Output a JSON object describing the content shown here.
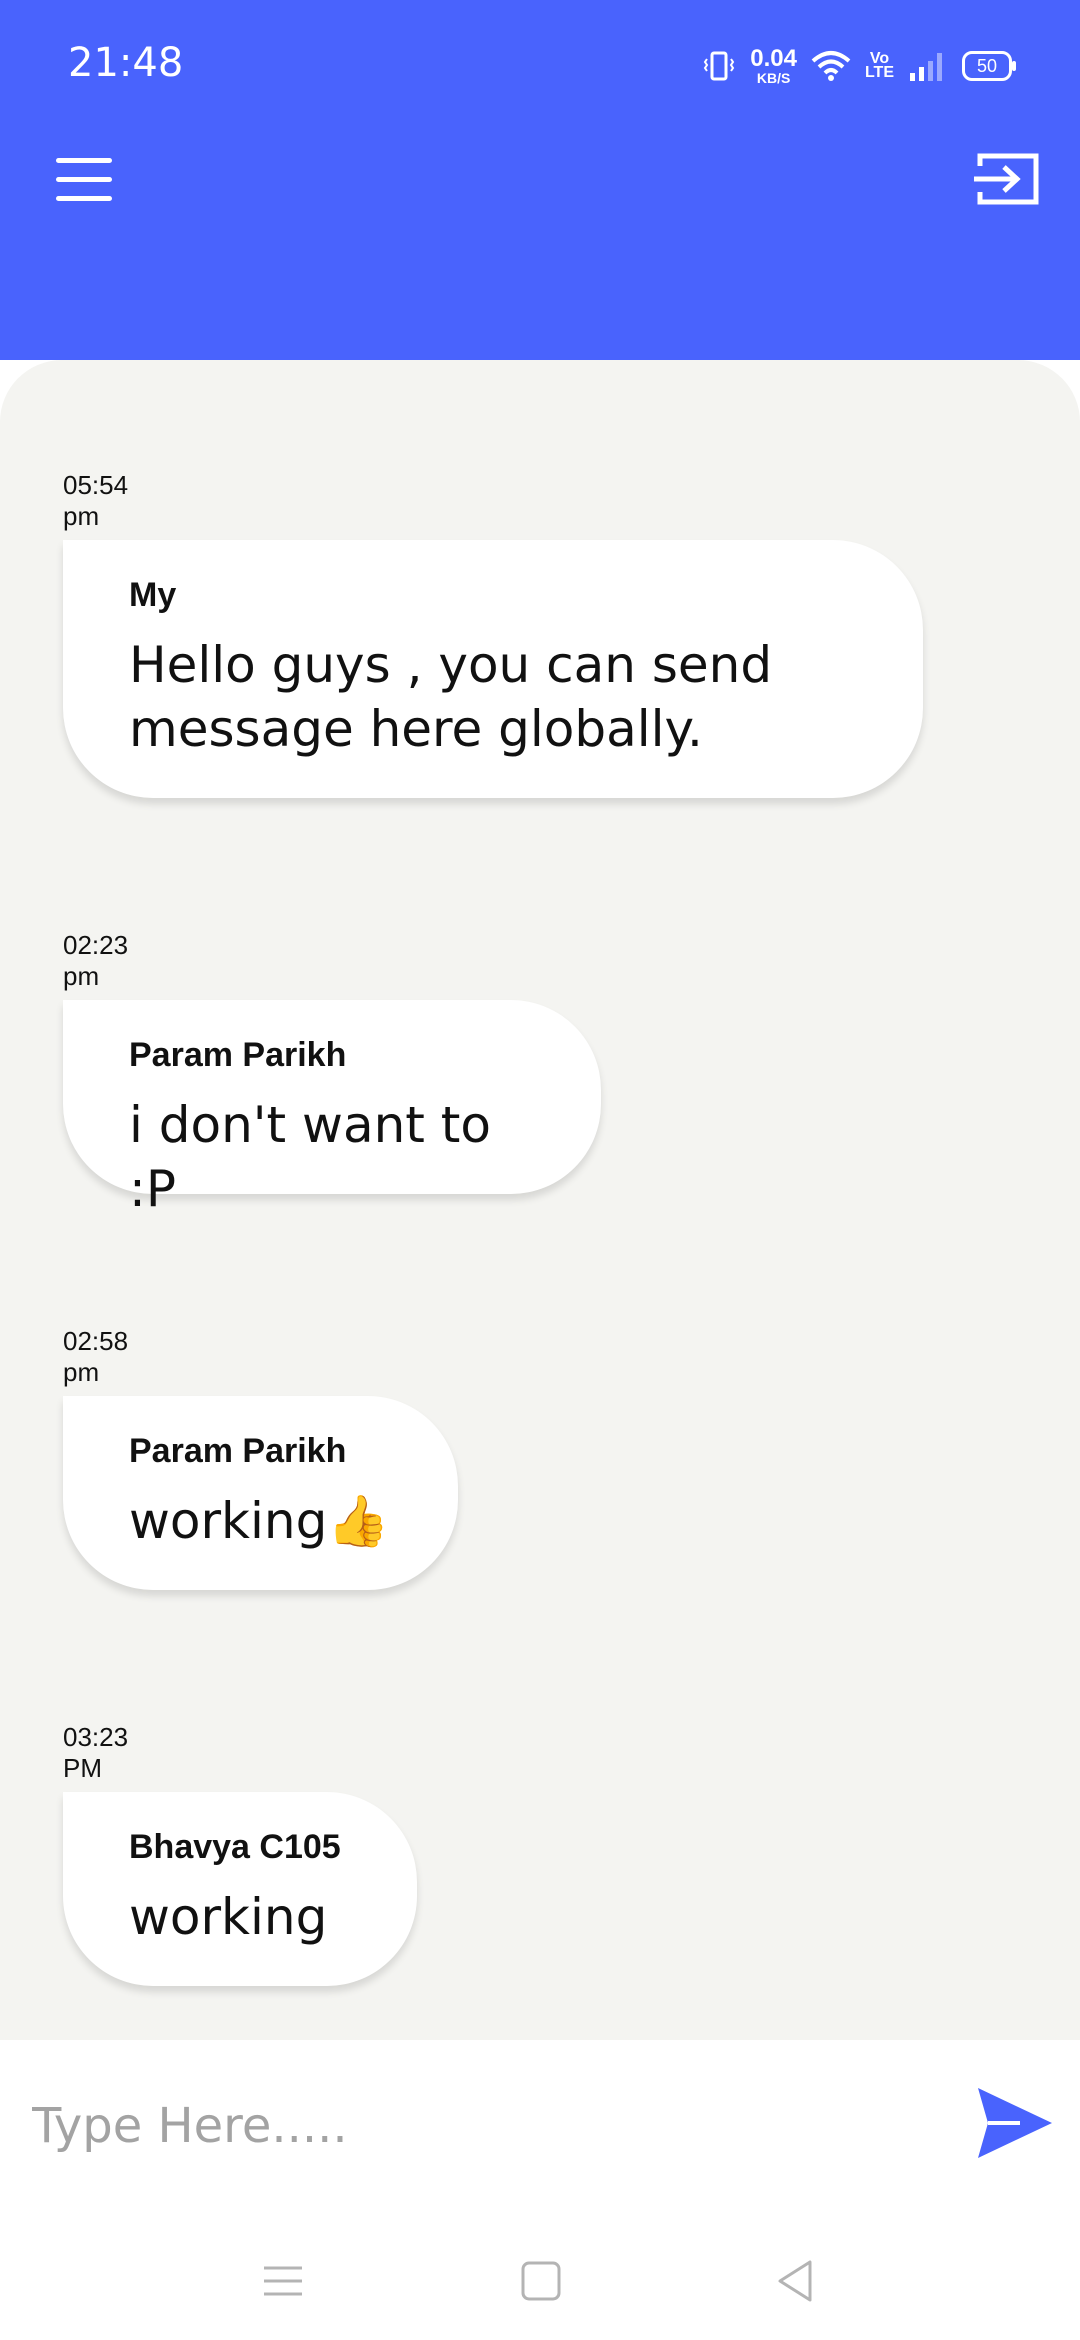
{
  "status_bar": {
    "time": "21:48",
    "net_speed": "0.04",
    "net_unit": "KB/S",
    "volte": "Vo\nLTE",
    "battery": "50",
    "icons": [
      "vibrate-icon",
      "wifi-icon",
      "signal-icon",
      "battery-icon"
    ]
  },
  "header": {
    "background": "#4963fd",
    "menu_icon": "hamburger-menu-icon",
    "logout_icon": "logout-icon"
  },
  "messages": [
    {
      "time": "05:54 pm",
      "sender": "My",
      "text": "Hello guys , you can send message here globally."
    },
    {
      "time": "02:23 pm",
      "sender": "Param Parikh",
      "text": "i don't want to :P"
    },
    {
      "time": "02:58 pm",
      "sender": "Param Parikh",
      "text": "working👍"
    },
    {
      "time": "03:23 PM",
      "sender": "Bhavya C105",
      "text": "working"
    }
  ],
  "composer": {
    "placeholder": "Type Here.....",
    "value": "",
    "send_icon": "send-icon"
  },
  "navigation": {
    "icons": [
      "recents-icon",
      "home-icon",
      "back-icon"
    ]
  }
}
